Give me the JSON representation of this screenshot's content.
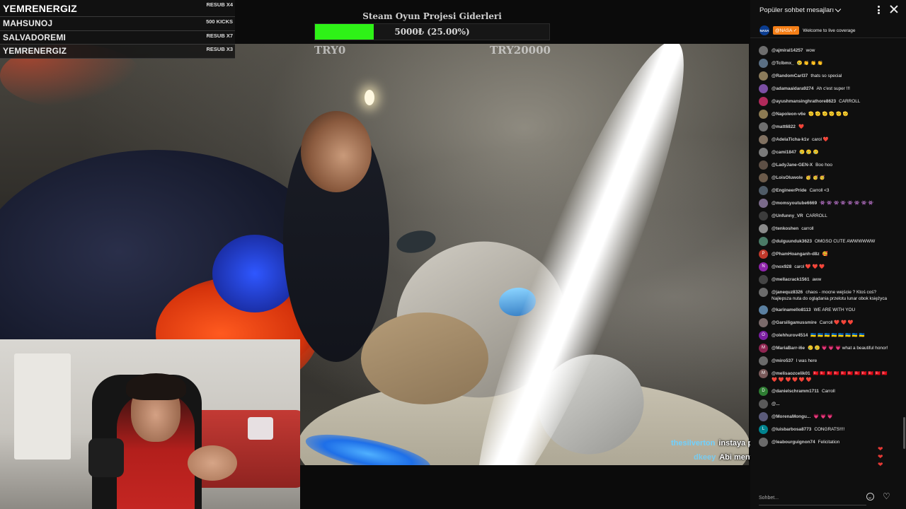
{
  "subs": [
    {
      "name": "YEMRENERGIZ",
      "amount": "RESUB X4"
    },
    {
      "name": "MAHSUNOJ",
      "amount": "500 KICKS"
    },
    {
      "name": "SALVADOREMI",
      "amount": "RESUB X7"
    },
    {
      "name": "YEMRENERGIZ",
      "amount": "RESUB X3"
    }
  ],
  "goal": {
    "title": "Steam Oyun Projesi Giderleri",
    "progress_text": "5000₺ (25.00%)",
    "progress_fraction": 0.25,
    "min_label": "TRY0",
    "max_label": "TRY20000",
    "fill_color": "#2ef217"
  },
  "overlay_chat": [
    {
      "user": "thesilverton",
      "message": "instaya post atmadan olmaz ama"
    },
    {
      "user": "dkeey",
      "message": "Abi mental baya iyimiş ya"
    }
  ],
  "chat": {
    "title": "Popüler sohbet mesajları",
    "pinned": {
      "avatar": "NASA",
      "badge": "@NASA ✓",
      "message": "Welcome to live coverage"
    },
    "messages": [
      {
        "author": "@ajmiral14257",
        "text": "wow",
        "avatar_color": "#6d6d6d"
      },
      {
        "author": "@Tclbmx_",
        "text": "😢 👏 👏 👏",
        "avatar_color": "#5a6f84"
      },
      {
        "author": "@RandomCarl37",
        "text": "thats so special",
        "avatar_color": "#8a7a5a"
      },
      {
        "author": "@adamaaidara9274",
        "text": "Ah c'est super !!!",
        "avatar_color": "#7b4fa3"
      },
      {
        "author": "@ayushmansinghrathore8623",
        "text": "CARROLL",
        "avatar_color": "#b02a5b"
      },
      {
        "author": "@Napoleon-v6e",
        "text": "🫡 🫡 🫡 🫡 🫡 🫡",
        "avatar_color": "#8c7a52"
      },
      {
        "author": "@matt6822",
        "text": "❤️",
        "avatar_color": "#6f6f6f"
      },
      {
        "author": "@AdelaTicha-k1v",
        "text": "carol ❤️",
        "avatar_color": "#807060"
      },
      {
        "author": "@cami1847",
        "text": "🥲 🥲 🥲",
        "avatar_color": "#7a7a7a"
      },
      {
        "author": "@LadyJane-GEN-X",
        "text": "Boo hoo",
        "avatar_color": "#5d4f45"
      },
      {
        "author": "@LoisOluwole",
        "text": "🥳 🥳 🥳",
        "avatar_color": "#6b5a4a"
      },
      {
        "author": "@EngineerPride",
        "text": "Carroll <3",
        "avatar_color": "#4e5a66"
      },
      {
        "author": "@momsyoutube6669",
        "text": "👾 👾 👾 👾 👾 👾 👾 👾",
        "avatar_color": "#7a6a8a"
      },
      {
        "author": "@Unfunny_VR",
        "text": "CARROLL",
        "avatar_color": "#3c3c3c"
      },
      {
        "author": "@tenkoshen",
        "text": "carroll",
        "avatar_color": "#8a8a8a"
      },
      {
        "author": "@dulguunduk3623",
        "text": "OMGSO CUTE AWWWWWW",
        "avatar_color": "#4a7a66"
      },
      {
        "author": "@PhamHoanganh-d8z",
        "text": "🥰",
        "avatar_color": "#c0392b",
        "avatar_letter": "P"
      },
      {
        "author": "@nox928",
        "text": "carol ❤️ ❤️ ❤️",
        "avatar_color": "#8e24aa",
        "avatar_letter": "N"
      },
      {
        "author": "@mellacrack1561",
        "text": "aww",
        "avatar_color": "#444444"
      },
      {
        "author": "@janequz8326",
        "text": "chaos - mocne wejście ? Ktoś coś? Najlepsza nuta do oglądania przelotu lunar obok księżyca",
        "avatar_color": "#6b6b6b"
      },
      {
        "author": "@karinamello8113",
        "text": "WE ARE WITH YOU",
        "avatar_color": "#5a7fa0"
      },
      {
        "author": "@Garsiligamussmire",
        "text": "Carroll ❤️ ❤️ ❤️",
        "avatar_color": "#7a6a6a"
      },
      {
        "author": "@olehhurov4514",
        "text": "🇺🇦 🇺🇦 🇺🇦 🇺🇦 🇺🇦 🇺🇦 🇺🇦 🇺🇦",
        "avatar_color": "#7b1fa2",
        "avatar_letter": "O"
      },
      {
        "author": "@MariaBarr-i6e",
        "text": "🥲 🥲 💗 💗 💗 what a beautiful honor!",
        "avatar_color": "#8e2450",
        "avatar_letter": "M"
      },
      {
        "author": "@miro537",
        "text": "I was here",
        "avatar_color": "#6a6a6a"
      },
      {
        "author": "@melisaozcelik01",
        "text": "🇹🇷 🇹🇷 🇹🇷 🇹🇷 🇹🇷 🇹🇷 🇹🇷 🇹🇷 🇹🇷 🇹🇷 🇹🇷 ❤️ ❤️ ❤️ ❤️ ❤️ ❤️",
        "avatar_color": "#7a5a5a",
        "avatar_letter": "M"
      },
      {
        "author": "@danielschramm1711",
        "text": "Carroll",
        "avatar_color": "#2e7d32",
        "avatar_letter": "D"
      },
      {
        "author": "@...",
        "text": "",
        "avatar_color": "#5a5a5a"
      },
      {
        "author": "@MorenaMongu...",
        "text": "💗 💗 💗",
        "avatar_color": "#5a5a7a"
      },
      {
        "author": "@luisbarbosa8773",
        "text": "CONGRATS!!!!",
        "avatar_color": "#00838f",
        "avatar_letter": "L"
      },
      {
        "author": "@leabourguignon74",
        "text": "Felicitation",
        "avatar_color": "#6a6a6a"
      }
    ],
    "input_placeholder": "Sohbet..."
  }
}
